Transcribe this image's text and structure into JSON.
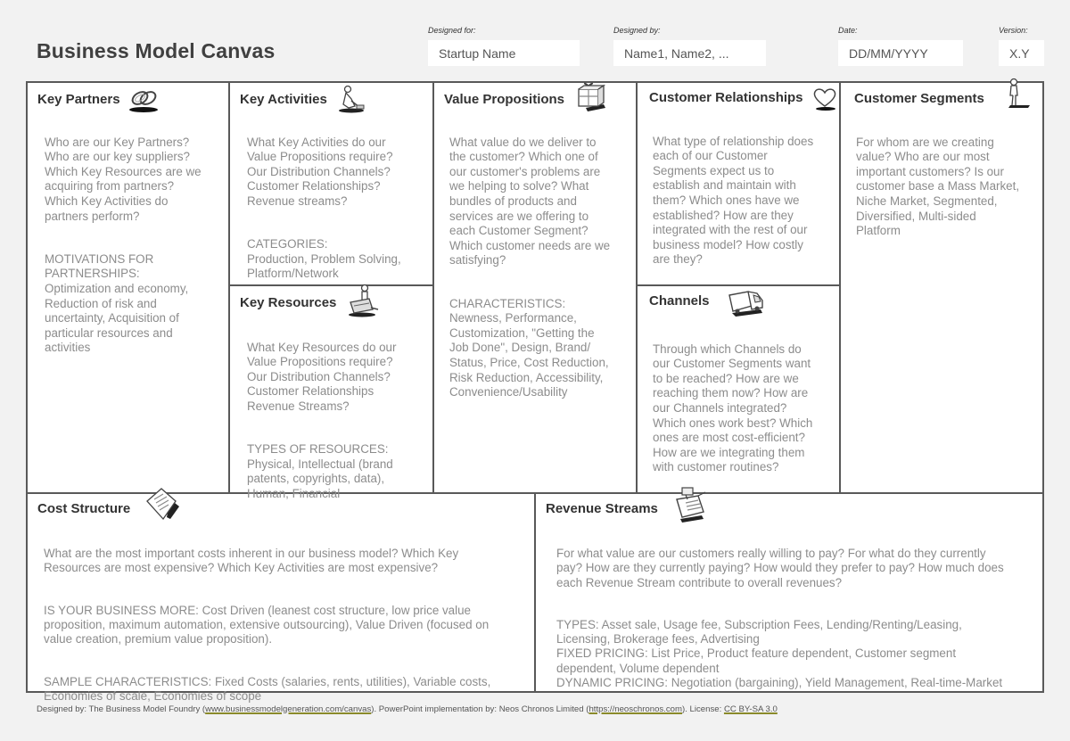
{
  "header": {
    "title": "Business Model Canvas",
    "designed_for": {
      "label": "Designed for:",
      "value": "Startup Name"
    },
    "designed_by": {
      "label": "Designed by:",
      "value": "Name1, Name2, ..."
    },
    "date": {
      "label": "Date:",
      "value": "DD/MM/YYYY"
    },
    "version": {
      "label": "Version:",
      "value": "X.Y"
    }
  },
  "blocks": {
    "key_partners": {
      "title": "Key Partners",
      "icon": "chain-link-icon",
      "paragraphs": [
        "Who are our Key Partners?\nWho are our key suppliers?\nWhich Key Resources are we\nacquiring from partners?\nWhich Key Activities do\npartners perform?",
        "MOTIVATIONS FOR\nPARTNERSHIPS:\nOptimization and economy,\nReduction of risk and\nuncertainty, Acquisition of\nparticular resources and\nactivities"
      ]
    },
    "key_activities": {
      "title": "Key Activities",
      "icon": "worker-icon",
      "paragraphs": [
        "What Key Activities do our\nValue Propositions require?\nOur Distribution Channels?\nCustomer Relationships?\nRevenue streams?",
        "CATEGORIES:\nProduction, Problem Solving,\nPlatform/Network"
      ]
    },
    "key_resources": {
      "title": "Key Resources",
      "icon": "forklift-icon",
      "paragraphs": [
        "What Key Resources do our\nValue Propositions require?\nOur Distribution Channels?\nCustomer Relationships\nRevenue Streams?",
        "TYPES OF RESOURCES:\nPhysical, Intellectual (brand\npatents, copyrights, data),\nHuman, Financial"
      ]
    },
    "value_propositions": {
      "title": "Value Propositions",
      "icon": "gift-icon",
      "paragraphs": [
        "What value do we deliver to\nthe customer? Which one of\nour customer's problems are\nwe helping to solve? What\nbundles of products and\nservices are we offering to\neach Customer Segment?\nWhich customer needs are we\nsatisfying?",
        "CHARACTERISTICS:\nNewness, Performance,\nCustomization, \"Getting the\nJob Done\", Design, Brand/\nStatus, Price, Cost Reduction,\nRisk Reduction, Accessibility,\nConvenience/Usability"
      ]
    },
    "customer_relationships": {
      "title": "Customer Relationships",
      "icon": "heart-icon",
      "paragraphs": [
        "What type of relationship does\neach of our Customer\nSegments expect us to\nestablish and maintain with\nthem? Which ones have we\nestablished? How are they\nintegrated with the rest of our\nbusiness model? How costly\nare they?"
      ]
    },
    "channels": {
      "title": "Channels",
      "icon": "truck-icon",
      "paragraphs": [
        "Through which Channels do\nour Customer Segments want\nto be reached? How are we\nreaching them now? How are\nour Channels integrated?\nWhich ones work best? Which\nones are most cost-efficient?\nHow are we integrating them\nwith customer routines?"
      ]
    },
    "customer_segments": {
      "title": "Customer Segments",
      "icon": "person-icon",
      "paragraphs": [
        "For whom are we creating\nvalue? Who are our most\nimportant customers? Is our\ncustomer base a Mass Market,\nNiche Market, Segmented,\nDiversified, Multi-sided\nPlatform"
      ]
    },
    "cost_structure": {
      "title": "Cost Structure",
      "icon": "invoice-icon",
      "paragraphs": [
        "What are the most important costs inherent in our business model? Which Key\nResources are most expensive? Which Key Activities are most expensive?",
        "IS YOUR BUSINESS MORE: Cost Driven (leanest cost structure, low price value\nproposition, maximum automation, extensive outsourcing), Value Driven (focused on\nvalue creation, premium value proposition).",
        "SAMPLE CHARACTERISTICS: Fixed Costs (salaries, rents, utilities), Variable costs,\nEconomies of scale, Economies of scope"
      ]
    },
    "revenue_streams": {
      "title": "Revenue Streams",
      "icon": "cash-register-icon",
      "paragraphs": [
        "For what value are our customers really willing to pay? For what do they currently\npay? How are they currently paying? How would they prefer to pay? How much does\neach Revenue Stream contribute to overall revenues?",
        "TYPES: Asset sale, Usage fee, Subscription Fees, Lending/Renting/Leasing,\nLicensing, Brokerage fees, Advertising\nFIXED PRICING: List Price, Product feature dependent, Customer segment\ndependent, Volume dependent\nDYNAMIC PRICING: Negotiation (bargaining), Yield Management, Real-time-Market"
      ]
    }
  },
  "footer": {
    "prefix": "Designed by: The Business Model Foundry (",
    "link1": "www.businessmodelgeneration.com/canvas",
    "middle": "). PowerPoint implementation by: Neos Chronos Limited (",
    "link2": "https://neoschronos.com",
    "suffix": "). License: ",
    "license": "CC BY-SA 3.0"
  },
  "colors": {
    "background": "#f2f2f2",
    "border": "#595959",
    "title_text": "#404040",
    "body_text": "#8c8c8c",
    "link_underline": "#8a8a2a"
  }
}
